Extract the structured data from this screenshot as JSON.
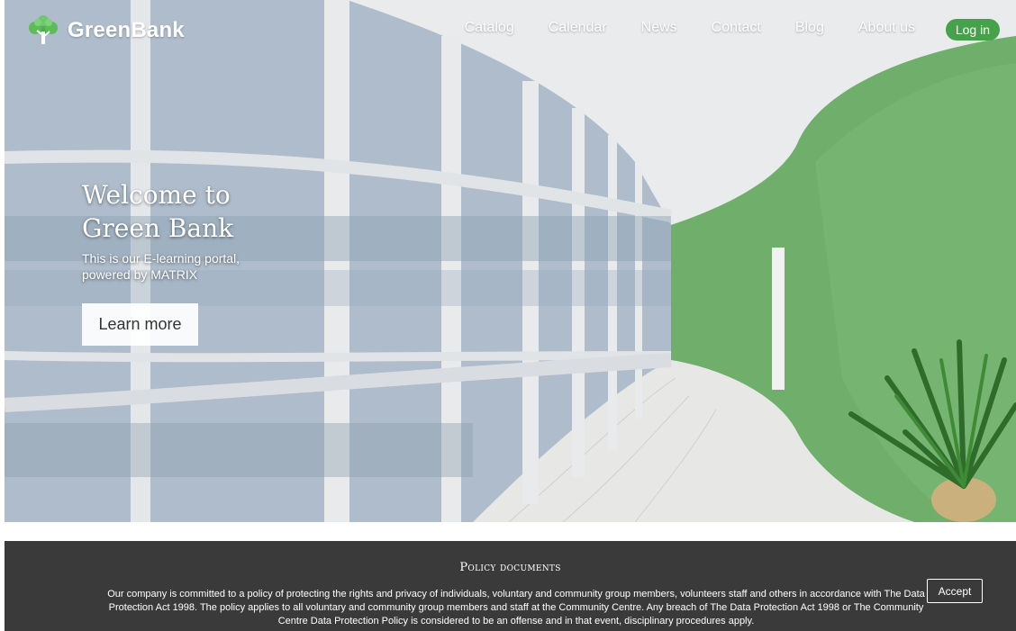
{
  "brand": {
    "name": "GreenBank"
  },
  "nav": {
    "links": [
      "Catalog",
      "Calendar",
      "News",
      "Contact",
      "Blog",
      "About us"
    ],
    "login_label": "Log in"
  },
  "hero": {
    "title_line1": "Welcome to",
    "title_line2": "Green Bank",
    "subtitle_line1": "This is our E-learning portal,",
    "subtitle_line2": "powered by MATRIX",
    "cta_label": "Learn more"
  },
  "policy": {
    "title": "Policy documents",
    "text": "Our company is committed to a policy of protecting the rights and privacy of individuals, voluntary and community group members, volunteers staff and others in accordance with The Data Protection Act 1998. The policy applies to all voluntary and community group members and staff at the Community Centre. Any breach of The Data Protection Act 1998 or The Community Centre Data Protection Policy is considered to be an offense and in that event, disciplinary procedures apply.",
    "accept_label": "Accept"
  },
  "colors": {
    "accent_green": "#46a24a",
    "wall_green": "#6fae6b",
    "policy_bg": "#3a3a3a"
  }
}
